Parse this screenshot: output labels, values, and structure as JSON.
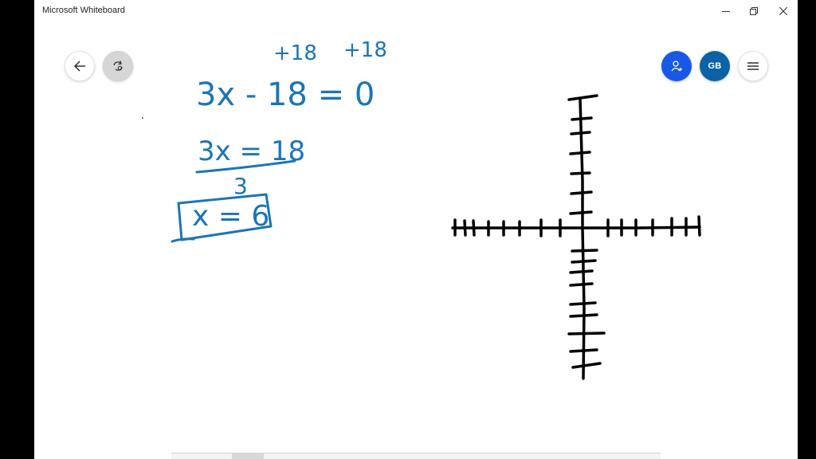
{
  "window": {
    "title": "Microsoft Whiteboard",
    "controls": {
      "minimize": "minimize-icon",
      "restore": "restore-icon",
      "close": "close-icon"
    }
  },
  "nav": {
    "back_icon": "back-arrow-icon",
    "sync_icon": "sync-settings-icon"
  },
  "header_right": {
    "invite_icon": "add-person-icon",
    "user_initials": "GB",
    "menu_icon": "hamburger-menu-icon"
  },
  "colors": {
    "ink_blue": "#1a75b8",
    "ink_black": "#000000",
    "invite_bg": "#1858e6",
    "avatar_bg": "#0b63a6"
  },
  "ink": {
    "step_annot_left": "+18",
    "step_annot_right": "+18",
    "equation": "3x - 18 = 0",
    "step2": "3x = 18",
    "divisor": "3",
    "answer": "x = 6"
  },
  "graph": {
    "description": "hand-drawn coordinate axes"
  }
}
